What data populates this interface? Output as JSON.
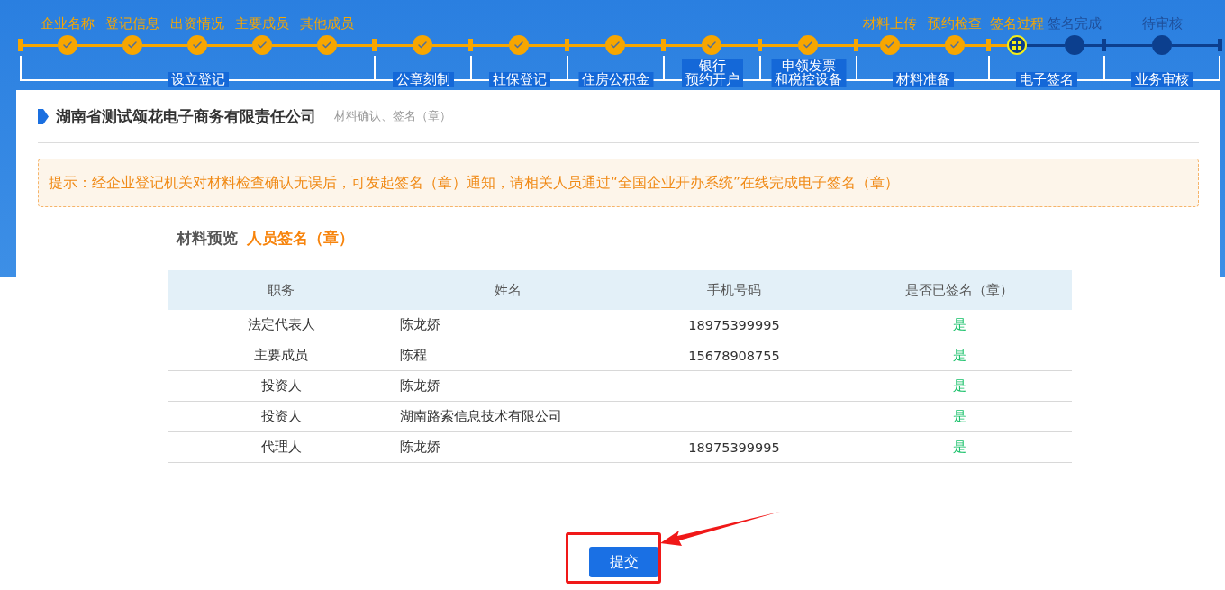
{
  "progress": {
    "phases": [
      {
        "label_lines": [
          "设立登记"
        ],
        "steps": [
          {
            "label": "企业名称",
            "done": true,
            "current": false
          },
          {
            "label": "登记信息",
            "done": true,
            "current": false
          },
          {
            "label": "出资情况",
            "done": true,
            "current": false
          },
          {
            "label": "主要成员",
            "done": true,
            "current": false
          },
          {
            "label": "其他成员",
            "done": true,
            "current": false
          }
        ]
      },
      {
        "label_lines": [
          "公章刻制"
        ],
        "steps": [
          {
            "done": true,
            "current": false
          }
        ]
      },
      {
        "label_lines": [
          "社保登记"
        ],
        "steps": [
          {
            "done": true,
            "current": false
          }
        ]
      },
      {
        "label_lines": [
          "住房公积金"
        ],
        "steps": [
          {
            "done": true,
            "current": false
          }
        ]
      },
      {
        "label_lines": [
          "银行",
          "预约开户"
        ],
        "steps": [
          {
            "done": true,
            "current": false
          }
        ]
      },
      {
        "label_lines": [
          "申领发票",
          "和税控设备"
        ],
        "steps": [
          {
            "done": true,
            "current": false
          }
        ]
      },
      {
        "label_lines": [
          "材料准备"
        ],
        "steps": [
          {
            "label": "材料上传",
            "done": true,
            "current": false
          },
          {
            "label": "预约检查",
            "done": true,
            "current": false
          }
        ]
      },
      {
        "label_lines": [
          "电子签名"
        ],
        "steps": [
          {
            "label": "签名过程",
            "done": false,
            "current": true
          },
          {
            "label": "签名完成",
            "done": false,
            "current": false
          }
        ]
      },
      {
        "label_lines": [
          "业务审核"
        ],
        "steps": [
          {
            "label": "待审核",
            "done": false,
            "current": false
          }
        ]
      }
    ]
  },
  "company": {
    "name": "湖南省测试颂花电子商务有限责任公司",
    "subtitle": "材料确认、签名（章）"
  },
  "notice": "提示：经企业登记机关对材料检查确认无误后，可发起签名（章）通知，请相关人员通过“全国企业开办系统”在线完成电子签名（章）",
  "section": {
    "label": "材料预览",
    "highlight": "人员签名（章）"
  },
  "table": {
    "columns": [
      "职务",
      "姓名",
      "手机号码",
      "是否已签名（章）"
    ],
    "rows": [
      {
        "role": "法定代表人",
        "name": "陈龙娇",
        "phone": "18975399995",
        "signed": "是"
      },
      {
        "role": "主要成员",
        "name": "陈程",
        "phone": "15678908755",
        "signed": "是"
      },
      {
        "role": "投资人",
        "name": "陈龙娇",
        "signed": "是"
      },
      {
        "role": "投资人",
        "name": "湖南路索信息技术有限公司",
        "signed": "是"
      },
      {
        "role": "代理人",
        "name": "陈龙娇",
        "phone": "18975399995",
        "signed": "是"
      }
    ]
  },
  "submit_button": "提交"
}
